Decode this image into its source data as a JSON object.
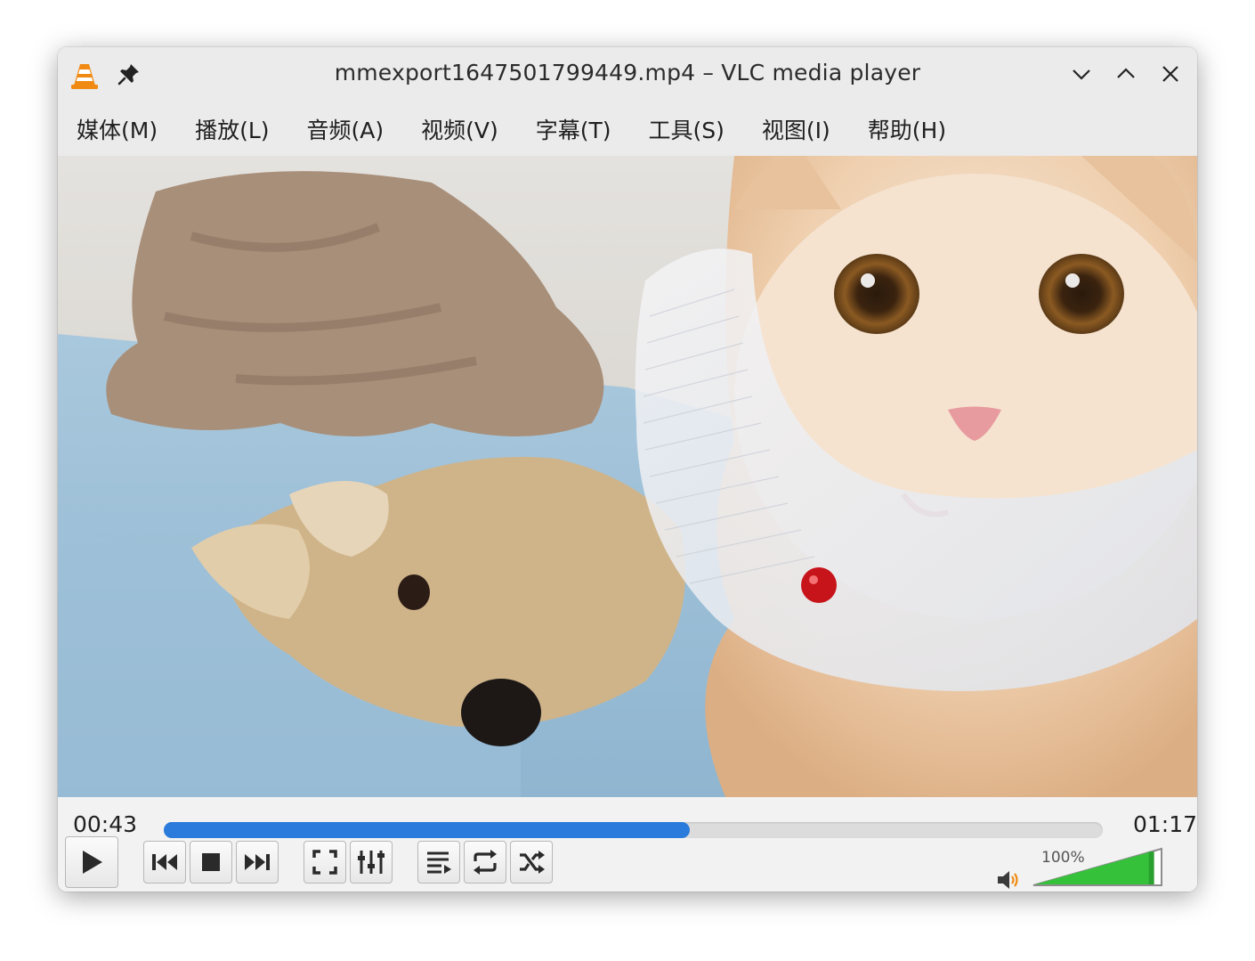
{
  "window": {
    "title": "mmexport1647501799449.mp4 – VLC media player"
  },
  "menubar": {
    "items": [
      {
        "label": "媒体(M)"
      },
      {
        "label": "播放(L)"
      },
      {
        "label": "音频(A)"
      },
      {
        "label": "视频(V)"
      },
      {
        "label": "字幕(T)"
      },
      {
        "label": "工具(S)"
      },
      {
        "label": "视图(I)"
      },
      {
        "label": "帮助(H)"
      }
    ]
  },
  "video": {
    "content": "cat-and-plush-toy-frame"
  },
  "playback": {
    "elapsed": "00:43",
    "total": "01:17",
    "progress_percent": 56
  },
  "volume": {
    "label": "100%",
    "level_percent": 100
  },
  "colors": {
    "accent": "#2a7bdc",
    "volume_fill": "#35c13a",
    "vlc_orange": "#f08a12"
  },
  "icons": {
    "app": "vlc-cone-icon",
    "pin": "pin-icon",
    "minimize": "chevron-down-icon",
    "maximize": "chevron-up-icon",
    "close": "close-icon",
    "play": "play-icon",
    "previous": "skip-previous-icon",
    "stop": "stop-icon",
    "next": "skip-next-icon",
    "fullscreen": "fullscreen-icon",
    "extended": "equalizer-icon",
    "playlist": "playlist-icon",
    "loop": "loop-icon",
    "random": "shuffle-icon",
    "speaker": "speaker-icon"
  }
}
